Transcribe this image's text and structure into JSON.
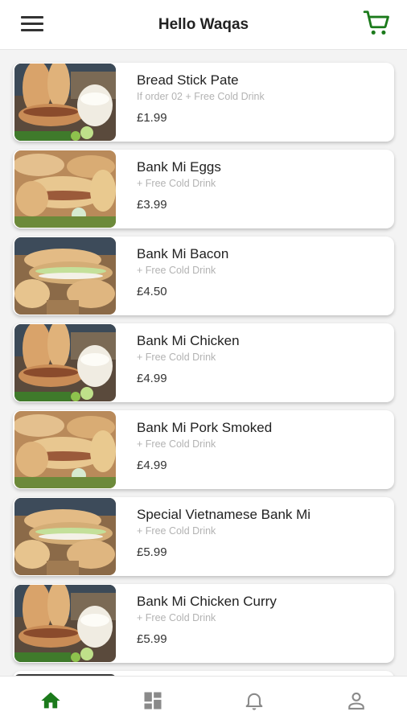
{
  "header": {
    "title": "Hello Waqas",
    "menu_icon": "menu-icon",
    "cart_icon": "cart-icon"
  },
  "colors": {
    "accent": "#1b7a1b",
    "inactive": "#8a8a8a"
  },
  "products": [
    {
      "name": "Bread Stick Pate",
      "subtitle": "If order 02 + Free Cold Drink",
      "price": "£1.99"
    },
    {
      "name": "Bank Mi Eggs",
      "subtitle": "+ Free Cold Drink",
      "price": "£3.99"
    },
    {
      "name": "Bank Mi Bacon",
      "subtitle": "+ Free Cold Drink",
      "price": "£4.50"
    },
    {
      "name": "Bank Mi Chicken",
      "subtitle": "+ Free Cold Drink",
      "price": "£4.99"
    },
    {
      "name": "Bank Mi Pork Smoked",
      "subtitle": "+ Free Cold Drink",
      "price": "£4.99"
    },
    {
      "name": "Special Vietnamese Bank Mi",
      "subtitle": "+ Free Cold Drink",
      "price": "£5.99"
    },
    {
      "name": "Bank Mi Chicken Curry",
      "subtitle": "+ Free Cold Drink",
      "price": "£5.99"
    }
  ],
  "bottom_nav": [
    {
      "icon": "home-icon",
      "active": true
    },
    {
      "icon": "dashboard-icon",
      "active": false
    },
    {
      "icon": "bell-icon",
      "active": false
    },
    {
      "icon": "profile-icon",
      "active": false
    }
  ]
}
